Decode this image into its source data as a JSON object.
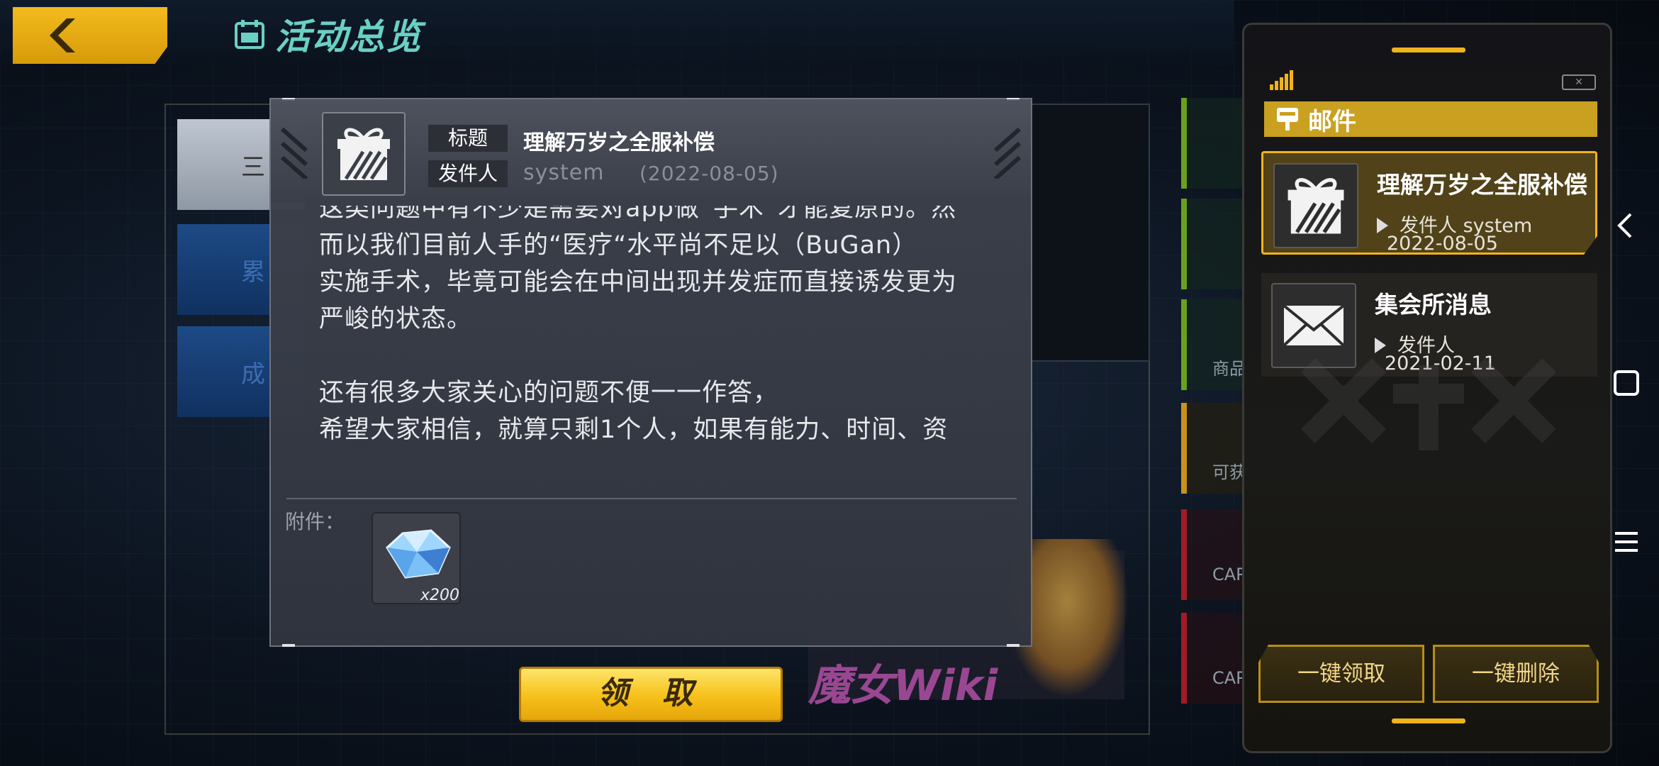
{
  "header": {
    "page_title": "活动总览"
  },
  "background": {
    "tabs": [
      "三",
      "累",
      "成"
    ],
    "right_items": [
      "商品",
      "可获",
      "CAP",
      "CAP"
    ],
    "watermark": "魔女Wiki"
  },
  "mail_detail": {
    "title_label": "标题",
    "title": "理解万岁之全服补偿",
    "sender_label": "发件人",
    "sender": "system",
    "date": "(2022-08-05)",
    "body_lines": [
      "这类问题中有不少是需要对app做“手术”才能复原的。然",
      "而以我们目前人手的“医疗“水平尚不足以（BuGan）",
      "实施手术，毕竟可能会在中间出现并发症而直接诱发更为",
      "严峻的状态。",
      "",
      "还有很多大家关心的问题不便一一作答，",
      "希望大家相信，就算只剩1个人，如果有能力、时间、资"
    ],
    "attachment_label": "附件：",
    "attachment": {
      "icon": "diamond-crystal-icon",
      "quantity": "x200"
    },
    "claim_button": "领 取"
  },
  "mail_panel": {
    "header": "邮件",
    "items": [
      {
        "title": "理解万岁之全服补偿",
        "sender_label": "发件人",
        "sender": "system",
        "date": "2022-08-05",
        "icon": "gift-icon",
        "selected": true
      },
      {
        "title": "集会所消息",
        "sender_label": "发件人",
        "sender": "",
        "date": "2021-02-11",
        "icon": "envelope-icon",
        "selected": false
      }
    ],
    "claim_all_button": "一键领取",
    "delete_all_button": "一键删除"
  },
  "colors": {
    "accent": "#f0b41a",
    "title_teal": "#6ad0c4",
    "dialog_bg": "#3e424c"
  }
}
